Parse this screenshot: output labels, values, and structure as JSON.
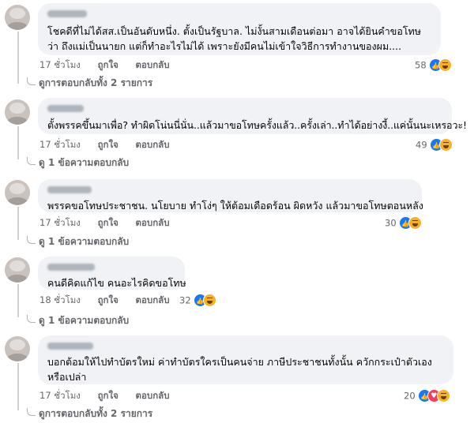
{
  "comments": [
    {
      "text": "โชคดีที่ไม่ได้สส.เป็นอันดับหนึ่ง. ตั้งเป็นรัฐบาล. ไม่งั้นสามเดือนต่อมา อาจได้ยินคำขอโทษว่า ถึงแม่เป็นนายก แต่ก็ทำอะไรไม่ได้ เพราะยังมีคนไม่เข้าใจวิธีการทำงานของผม....",
      "time": "17 ชั่วโมง",
      "like": "ถูกใจ",
      "reply": "ตอบกลับ",
      "reaction_count": "58",
      "reactions": [
        "like-icon",
        "haha-icon"
      ],
      "replies_label": "ดูการตอบกลับทั้ง 2 รายการ"
    },
    {
      "text": "ตั้งพรรคขึ้นมาเพื่อ? ทำผิดโน่นนี่นั่น..แล้วมาขอโทษครั้งแล้ว..ครั้งเล่า..ทำได้อย่างงี้..แค่นั้นนะเหรอวะ!",
      "time": "17 ชั่วโมง",
      "like": "ถูกใจ",
      "reply": "ตอบกลับ",
      "reaction_count": "49",
      "reactions": [
        "like-icon",
        "haha-icon"
      ],
      "replies_label": "ดู 1 ข้อความตอบกลับ"
    },
    {
      "text": "พรรคขอโทษประชาชน. นโยบาย ทำโง่ๆ ให้ต้อมเดือดร้อน ผิดหวัง แล้วมาขอโทษตอนหลัง",
      "time": "17 ชั่วโมง",
      "like": "ถูกใจ",
      "reply": "ตอบกลับ",
      "reaction_count": "30",
      "reactions": [
        "like-icon",
        "haha-icon"
      ],
      "replies_label": "ดู 1 ข้อความตอบกลับ"
    },
    {
      "text": "คนดีคิดแก้ไข คนอะไรคิดขอโทษ",
      "time": "18 ชั่วโมง",
      "like": "ถูกใจ",
      "reply": "ตอบกลับ",
      "reaction_count": "32",
      "reactions": [
        "like-icon",
        "haha-icon"
      ],
      "replies_label": "ดู 1 ข้อความตอบกลับ"
    },
    {
      "text": "บอกต้อมให้ไปทำบัตรใหม่ ค่าทำบัตรใครเป็นคนจ่าย ภาษีประชาชนทั้งนั้น ควักกระเป๋าตัวเองหรือเปล่า",
      "time": "17 ชั่วโมง",
      "like": "ถูกใจ",
      "reply": "ตอบกลับ",
      "reaction_count": "20",
      "reactions": [
        "like-icon",
        "love-icon",
        "haha-icon"
      ],
      "replies_label": "ดูการตอบกลับทั้ง 2 รายการ"
    }
  ]
}
